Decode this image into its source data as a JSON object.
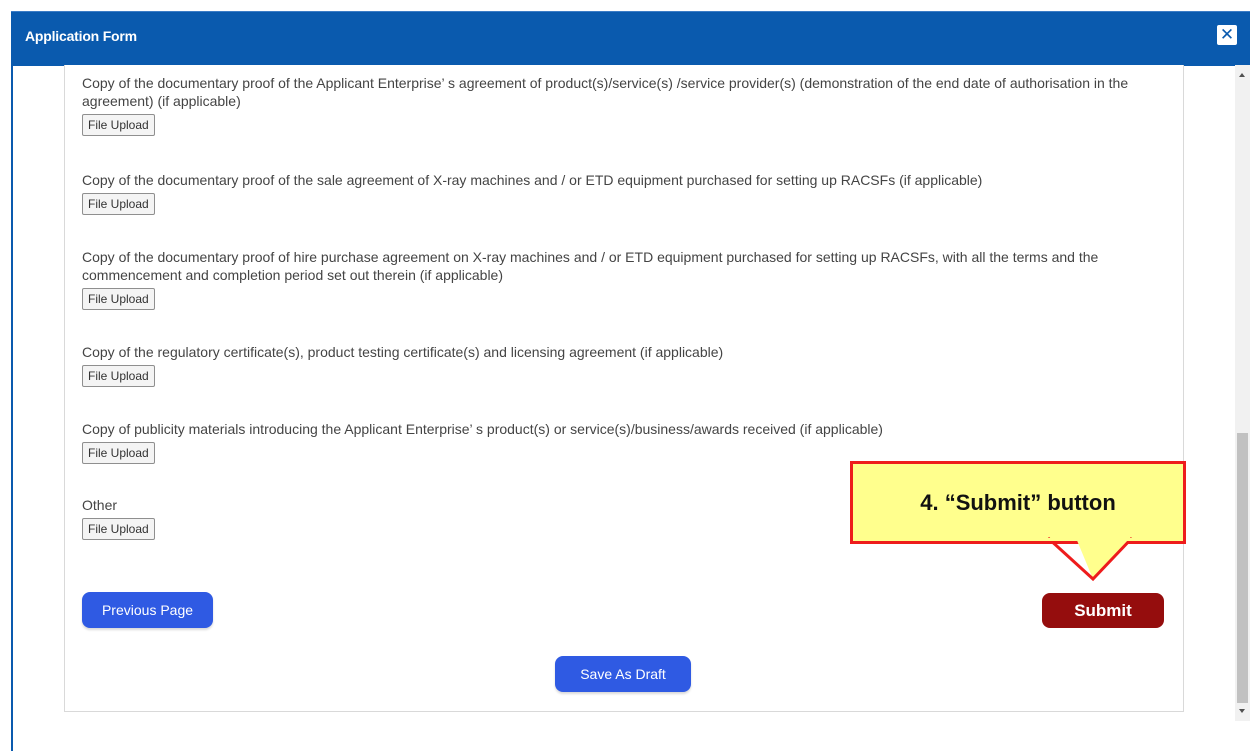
{
  "window": {
    "title": "Application Form",
    "close_symbol": "✕",
    "title_bar_color": "#0a5aae"
  },
  "documents": [
    {
      "label": "Copy of the documentary proof of the Applicant Enterprise’ s agreement of product(s)/service(s) /service provider(s) (demonstration of the end date of authorisation in the agreement) (if applicable)",
      "button": "File Upload"
    },
    {
      "label": "Copy of the documentary proof of the sale agreement of X-ray machines and / or ETD equipment purchased for setting up RACSFs (if applicable)",
      "button": "File Upload"
    },
    {
      "label": "Copy of the documentary proof of hire purchase agreement on X-ray machines and / or ETD equipment purchased for setting up RACSFs, with all the terms and the commencement and completion period set out therein (if applicable)",
      "button": "File Upload"
    },
    {
      "label": "Copy of the regulatory certificate(s), product testing certificate(s) and licensing agreement (if applicable)",
      "button": "File Upload"
    },
    {
      "label": "Copy of publicity materials introducing the Applicant Enterprise’ s product(s) or service(s)/business/awards received (if applicable)",
      "button": "File Upload"
    },
    {
      "label": "Other",
      "button": "File Upload"
    }
  ],
  "actions": {
    "previous": "Previous Page",
    "submit": "Submit",
    "save_draft": "Save As Draft"
  },
  "annotation": {
    "text": "4. “Submit” button",
    "fill_color": "#ffff8d",
    "border_color": "#ee1c1c"
  },
  "colors": {
    "primary_button": "#2f5ae3",
    "submit_button": "#950d0d"
  }
}
